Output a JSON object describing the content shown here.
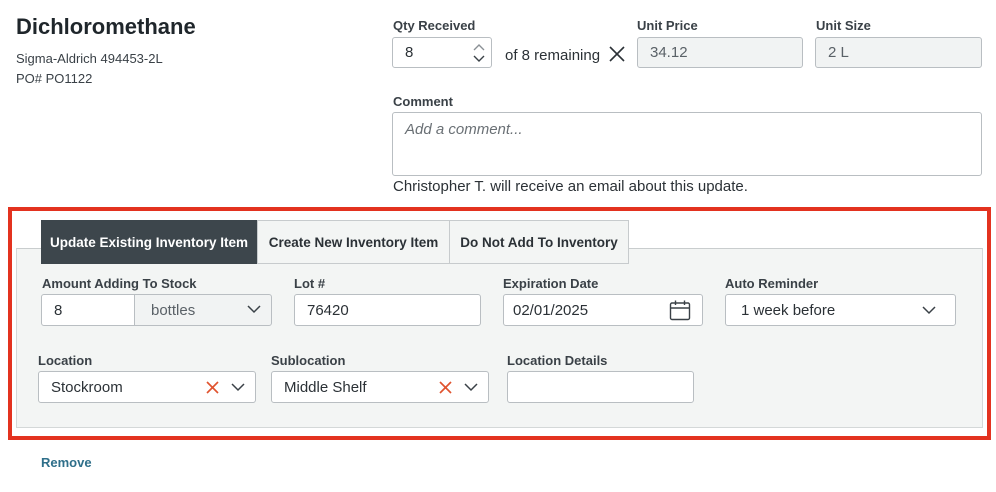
{
  "item": {
    "name": "Dichloromethane",
    "catalog": "Sigma-Aldrich 494453-2L",
    "po": "PO# PO1122"
  },
  "qty": {
    "label": "Qty Received",
    "value": "8",
    "remaining": "of 8 remaining"
  },
  "unit_price": {
    "label": "Unit Price",
    "value": "34.12"
  },
  "unit_size": {
    "label": "Unit Size",
    "value": "2 L"
  },
  "comment": {
    "label": "Comment",
    "placeholder": "Add a comment...",
    "note": "Christopher T. will receive an email about this update."
  },
  "tabs": [
    {
      "label": "Update Existing Inventory Item",
      "active": true
    },
    {
      "label": "Create New Inventory Item",
      "active": false
    },
    {
      "label": "Do Not Add To Inventory",
      "active": false
    }
  ],
  "form": {
    "amount": {
      "label": "Amount Adding To Stock",
      "value": "8",
      "unit": "bottles"
    },
    "lot": {
      "label": "Lot #",
      "value": "76420"
    },
    "expiration": {
      "label": "Expiration Date",
      "value": "02/01/2025"
    },
    "reminder": {
      "label": "Auto Reminder",
      "value": "1 week before"
    },
    "location": {
      "label": "Location",
      "value": "Stockroom"
    },
    "sublocation": {
      "label": "Sublocation",
      "value": "Middle Shelf"
    },
    "location_details": {
      "label": "Location Details",
      "value": ""
    }
  },
  "remove_label": "Remove",
  "colors": {
    "highlight": "#e3321f",
    "active_tab": "#3d464c",
    "clear_x": "#e0532f",
    "link": "#2f6f8a"
  }
}
